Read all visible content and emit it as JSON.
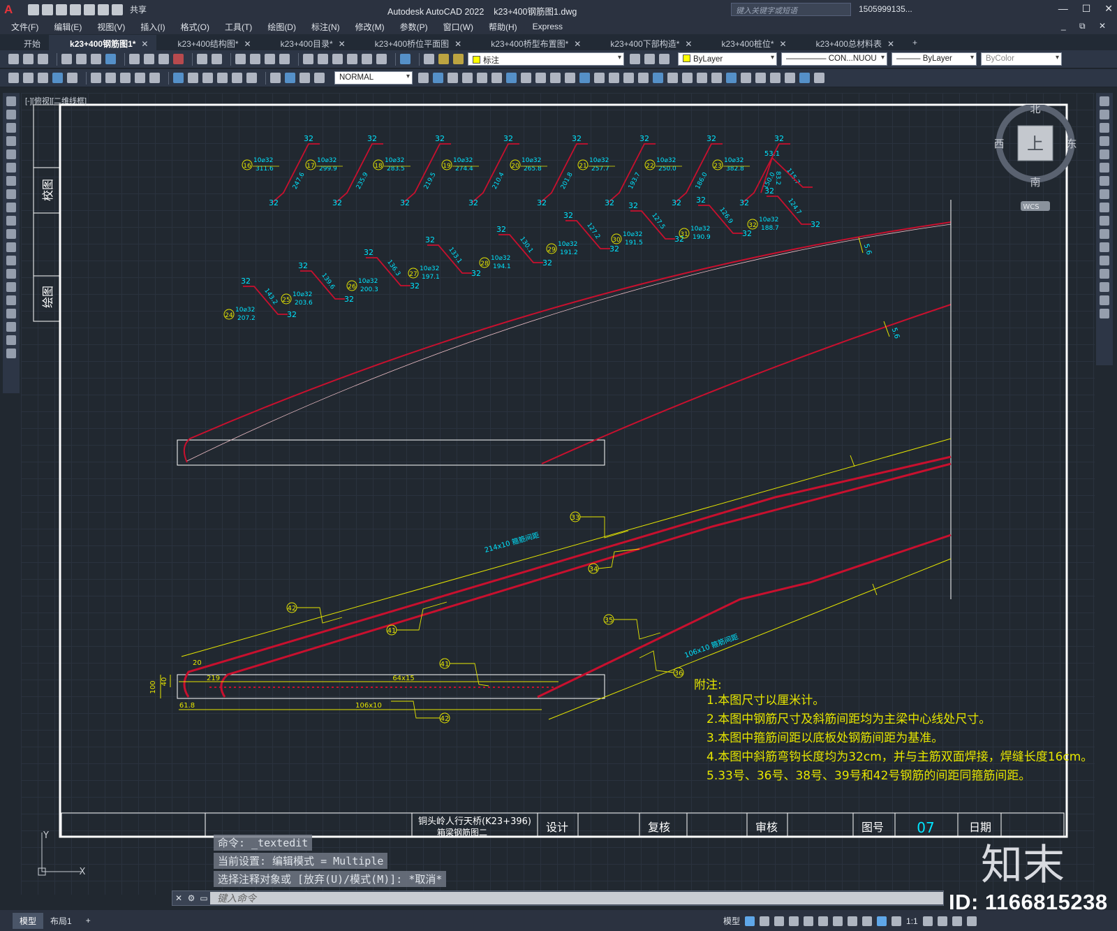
{
  "titlebar": {
    "logo": "A",
    "share": "共享",
    "app_title": "Autodesk AutoCAD 2022",
    "file_name": "k23+400钢筋图1.dwg",
    "search_placeholder": "键入关键字或短语",
    "user": "1505999135..."
  },
  "menu": [
    "文件(F)",
    "编辑(E)",
    "视图(V)",
    "插入(I)",
    "格式(O)",
    "工具(T)",
    "绘图(D)",
    "标注(N)",
    "修改(M)",
    "参数(P)",
    "窗口(W)",
    "帮助(H)",
    "Express"
  ],
  "tabs": [
    {
      "label": "开始",
      "closable": false,
      "active": false
    },
    {
      "label": "k23+400钢筋图1*",
      "closable": true,
      "active": true
    },
    {
      "label": "k23+400结构图*",
      "closable": true,
      "active": false
    },
    {
      "label": "k23+400目录*",
      "closable": true,
      "active": false
    },
    {
      "label": "k23+400桥位平面图",
      "closable": true,
      "active": false
    },
    {
      "label": "k23+400桥型布置图*",
      "closable": true,
      "active": false
    },
    {
      "label": "k23+400下部构造*",
      "closable": true,
      "active": false
    },
    {
      "label": "k23+400桩位*",
      "closable": true,
      "active": false
    },
    {
      "label": "k23+400总材料表",
      "closable": true,
      "active": false
    }
  ],
  "toolbar1": {
    "layer": "标注",
    "color": "ByLayer",
    "linetype": "CON...NUOU",
    "lineweight": "ByLayer",
    "plotstyle": "ByColor"
  },
  "toolbar2": {
    "mode": "NORMAL"
  },
  "viewport_label": "[-][俯视][二维线框]",
  "viewcube": {
    "north": "北",
    "south": "南",
    "east": "东",
    "west": "西",
    "top": "上",
    "wcs": "WCS"
  },
  "stamps": [
    "校图",
    "绘图"
  ],
  "bent_bars_row1": [
    {
      "no": "16",
      "spec": "10⌀32",
      "len": "311.6",
      "diag": "247.6"
    },
    {
      "no": "17",
      "spec": "10⌀32",
      "len": "299.9",
      "diag": "235.9"
    },
    {
      "no": "18",
      "spec": "10⌀32",
      "len": "283.5",
      "diag": "219.5"
    },
    {
      "no": "19",
      "spec": "10⌀32",
      "len": "274.4",
      "diag": "210.4"
    },
    {
      "no": "20",
      "spec": "10⌀32",
      "len": "265.8",
      "diag": "201.8"
    },
    {
      "no": "21",
      "spec": "10⌀32",
      "len": "257.7",
      "diag": "193.7"
    },
    {
      "no": "22",
      "spec": "10⌀32",
      "len": "250.0",
      "diag": "186.0"
    },
    {
      "no": "23",
      "spec": "10⌀32",
      "len": "382.8",
      "diag": "150.0"
    }
  ],
  "bar23_extra": {
    "a": "53.1",
    "b": "83.2",
    "c": "115.7"
  },
  "bent_bars_row2": [
    {
      "no": "24",
      "spec": "10⌀32",
      "len": "207.2",
      "diag": "143.2"
    },
    {
      "no": "25",
      "spec": "10⌀32",
      "len": "203.6",
      "diag": "139.6"
    },
    {
      "no": "26",
      "spec": "10⌀32",
      "len": "200.3",
      "diag": "136.3"
    },
    {
      "no": "27",
      "spec": "10⌀32",
      "len": "197.1",
      "diag": "133.1"
    },
    {
      "no": "28",
      "spec": "10⌀32",
      "len": "194.1",
      "diag": "130.1"
    },
    {
      "no": "29",
      "spec": "10⌀32",
      "len": "191.2",
      "diag": "127.2"
    },
    {
      "no": "30",
      "spec": "10⌀32",
      "len": "191.5",
      "diag": "127.5"
    },
    {
      "no": "31",
      "spec": "10⌀32",
      "len": "190.9",
      "diag": "126.9"
    },
    {
      "no": "32",
      "spec": "10⌀32",
      "len": "188.7",
      "diag": "124.7"
    }
  ],
  "hook": "32",
  "dims": {
    "d56a": "5.6",
    "d56b": "5.6",
    "stirrup_top": "214x10 箍筋间距",
    "stirrup_bot": "106x10 箍筋间距",
    "d20": "20",
    "d219": "219",
    "d40": "40",
    "d100": "100",
    "d64": "64x15",
    "d618": "61.8",
    "d106": "106x10"
  },
  "callouts": [
    "33",
    "34",
    "35",
    "36",
    "41",
    "41",
    "42",
    "42"
  ],
  "notes": {
    "title": "附注:",
    "items": [
      "1.本图尺寸以厘米计。",
      "2.本图中钢筋尺寸及斜筋间距均为主梁中心线处尺寸。",
      "3.本图中箍筋间距以底板处钢筋间距为基准。",
      "4.本图中斜筋弯钩长度均为32cm，并与主筋双面焊接，焊缝长度16cm。",
      "5.33号、36号、38号、39号和42号钢筋的间距同箍筋间距。"
    ]
  },
  "titleblock": {
    "project": "铜头岭人行天桥(K23+396)",
    "subtitle": "箱梁钢筋图二",
    "design": "设计",
    "check": "复核",
    "review": "审核",
    "drawing_no_label": "图号",
    "drawing_no": "07",
    "date": "日期"
  },
  "command_history": [
    "命令: _textedit",
    "当前设置: 编辑模式 = Multiple",
    "选择注释对象或 [放弃(U)/模式(M)]: *取消*"
  ],
  "command_placeholder": "键入命令",
  "ucs": {
    "y": "Y",
    "x": "X"
  },
  "status": {
    "model_tab": "模型",
    "layout_tab": "布局1",
    "plus": "+",
    "model": "模型",
    "scale": "1:1"
  },
  "watermark": {
    "logo": "知末",
    "id": "ID: 1166815238"
  },
  "colors": {
    "red": "#c8102e",
    "yellow": "#e6e600",
    "cyan": "#00e5ff",
    "white": "#ffffff"
  }
}
